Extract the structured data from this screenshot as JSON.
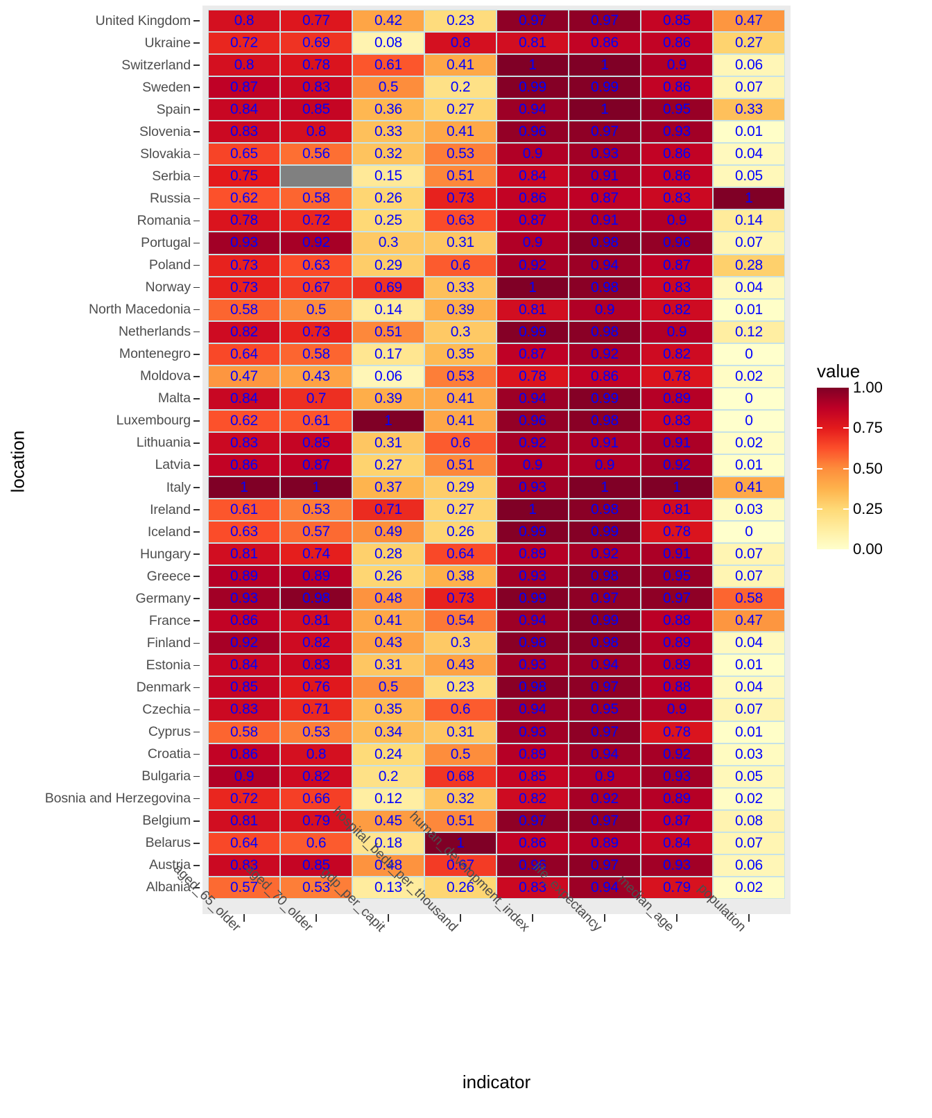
{
  "axes": {
    "y_title": "location",
    "x_title": "indicator"
  },
  "legend": {
    "title": "value",
    "ticks": [
      "1.00",
      "0.75",
      "0.50",
      "0.25",
      "0.00"
    ],
    "tick_values": [
      1.0,
      0.75,
      0.5,
      0.25,
      0.0
    ],
    "low_color": "#ffffcc",
    "high_color": "#800026",
    "na_color": "#808080"
  },
  "chart_data": {
    "type": "heatmap",
    "title": "",
    "xlabel": "indicator",
    "ylabel": "location",
    "legend_title": "value",
    "zlim": [
      0,
      1
    ],
    "grid": false,
    "legend_position": "right",
    "na_color": "#808080",
    "colormap": [
      "#ffffcc",
      "#ffeda0",
      "#fed976",
      "#feb24c",
      "#fd8d3c",
      "#fc4e2a",
      "#e31a1c",
      "#bd0026",
      "#800026"
    ],
    "columns": [
      "aged_65_older",
      "aged_70_older",
      "gdp_per_capit",
      "hospital_beds_per_thousand",
      "human_development_index",
      "life_expectancy",
      "median_age",
      "population"
    ],
    "rows": [
      "United Kingdom",
      "Ukraine",
      "Switzerland",
      "Sweden",
      "Spain",
      "Slovenia",
      "Slovakia",
      "Serbia",
      "Russia",
      "Romania",
      "Portugal",
      "Poland",
      "Norway",
      "North Macedonia",
      "Netherlands",
      "Montenegro",
      "Moldova",
      "Malta",
      "Luxembourg",
      "Lithuania",
      "Latvia",
      "Italy",
      "Ireland",
      "Iceland",
      "Hungary",
      "Greece",
      "Germany",
      "France",
      "Finland",
      "Estonia",
      "Denmark",
      "Czechia",
      "Cyprus",
      "Croatia",
      "Bulgaria",
      "Bosnia and Herzegovina",
      "Belgium",
      "Belarus",
      "Austria",
      "Albania"
    ],
    "values": [
      [
        0.8,
        0.77,
        0.42,
        0.23,
        0.97,
        0.97,
        0.85,
        0.47
      ],
      [
        0.72,
        0.69,
        0.08,
        0.8,
        0.81,
        0.86,
        0.86,
        0.27
      ],
      [
        0.8,
        0.78,
        0.61,
        0.41,
        1,
        1,
        0.9,
        0.06
      ],
      [
        0.87,
        0.83,
        0.5,
        0.2,
        0.99,
        0.99,
        0.86,
        0.07
      ],
      [
        0.84,
        0.85,
        0.36,
        0.27,
        0.94,
        1,
        0.95,
        0.33
      ],
      [
        0.83,
        0.8,
        0.33,
        0.41,
        0.96,
        0.97,
        0.93,
        0.01
      ],
      [
        0.65,
        0.56,
        0.32,
        0.53,
        0.9,
        0.93,
        0.86,
        0.04
      ],
      [
        0.75,
        null,
        0.15,
        0.51,
        0.84,
        0.91,
        0.86,
        0.05
      ],
      [
        0.62,
        0.58,
        0.26,
        0.73,
        0.86,
        0.87,
        0.83,
        1
      ],
      [
        0.78,
        0.72,
        0.25,
        0.63,
        0.87,
        0.91,
        0.9,
        0.14
      ],
      [
        0.93,
        0.92,
        0.3,
        0.31,
        0.9,
        0.98,
        0.96,
        0.07
      ],
      [
        0.73,
        0.63,
        0.29,
        0.6,
        0.92,
        0.94,
        0.87,
        0.28
      ],
      [
        0.73,
        0.67,
        0.69,
        0.33,
        1,
        0.98,
        0.83,
        0.04
      ],
      [
        0.58,
        0.5,
        0.14,
        0.39,
        0.81,
        0.9,
        0.82,
        0.01
      ],
      [
        0.82,
        0.73,
        0.51,
        0.3,
        0.99,
        0.98,
        0.9,
        0.12
      ],
      [
        0.64,
        0.58,
        0.17,
        0.35,
        0.87,
        0.92,
        0.82,
        0
      ],
      [
        0.47,
        0.43,
        0.06,
        0.53,
        0.78,
        0.86,
        0.78,
        0.02
      ],
      [
        0.84,
        0.7,
        0.39,
        0.41,
        0.94,
        0.99,
        0.89,
        0
      ],
      [
        0.62,
        0.61,
        1,
        0.41,
        0.96,
        0.98,
        0.83,
        0
      ],
      [
        0.83,
        0.85,
        0.31,
        0.6,
        0.92,
        0.91,
        0.91,
        0.02
      ],
      [
        0.86,
        0.87,
        0.27,
        0.51,
        0.9,
        0.9,
        0.92,
        0.01
      ],
      [
        1,
        1,
        0.37,
        0.29,
        0.93,
        1,
        1,
        0.41
      ],
      [
        0.61,
        0.53,
        0.71,
        0.27,
        1,
        0.98,
        0.81,
        0.03
      ],
      [
        0.63,
        0.57,
        0.49,
        0.26,
        0.99,
        0.99,
        0.78,
        0
      ],
      [
        0.81,
        0.74,
        0.28,
        0.64,
        0.89,
        0.92,
        0.91,
        0.07
      ],
      [
        0.89,
        0.89,
        0.26,
        0.38,
        0.93,
        0.98,
        0.95,
        0.07
      ],
      [
        0.93,
        0.98,
        0.48,
        0.73,
        0.99,
        0.97,
        0.97,
        0.58
      ],
      [
        0.86,
        0.81,
        0.41,
        0.54,
        0.94,
        0.99,
        0.88,
        0.47
      ],
      [
        0.92,
        0.82,
        0.43,
        0.3,
        0.98,
        0.98,
        0.89,
        0.04
      ],
      [
        0.84,
        0.83,
        0.31,
        0.43,
        0.93,
        0.94,
        0.89,
        0.01
      ],
      [
        0.85,
        0.76,
        0.5,
        0.23,
        0.98,
        0.97,
        0.88,
        0.04
      ],
      [
        0.83,
        0.71,
        0.35,
        0.6,
        0.94,
        0.95,
        0.9,
        0.07
      ],
      [
        0.58,
        0.53,
        0.34,
        0.31,
        0.93,
        0.97,
        0.78,
        0.01
      ],
      [
        0.86,
        0.8,
        0.24,
        0.5,
        0.89,
        0.94,
        0.92,
        0.03
      ],
      [
        0.9,
        0.82,
        0.2,
        0.68,
        0.85,
        0.9,
        0.93,
        0.05
      ],
      [
        0.72,
        0.66,
        0.12,
        0.32,
        0.82,
        0.92,
        0.89,
        0.02
      ],
      [
        0.81,
        0.79,
        0.45,
        0.51,
        0.97,
        0.97,
        0.87,
        0.08
      ],
      [
        0.64,
        0.6,
        0.18,
        1,
        0.86,
        0.89,
        0.84,
        0.07
      ],
      [
        0.83,
        0.85,
        0.48,
        0.67,
        0.96,
        0.97,
        0.93,
        0.06
      ],
      [
        0.57,
        0.53,
        0.13,
        0.26,
        0.83,
        0.94,
        0.79,
        0.02
      ]
    ],
    "labels": [
      [
        "0.8",
        "0.77",
        "0.42",
        "0.23",
        "0.97",
        "0.97",
        "0.85",
        "0.47"
      ],
      [
        "0.72",
        "0.69",
        "0.08",
        "0.8",
        "0.81",
        "0.86",
        "0.86",
        "0.27"
      ],
      [
        "0.8",
        "0.78",
        "0.61",
        "0.41",
        "1",
        "1",
        "0.9",
        "0.06"
      ],
      [
        "0.87",
        "0.83",
        "0.5",
        "0.2",
        "0.99",
        "0.99",
        "0.86",
        "0.07"
      ],
      [
        "0.84",
        "0.85",
        "0.36",
        "0.27",
        "0.94",
        "1",
        "0.95",
        "0.33"
      ],
      [
        "0.83",
        "0.8",
        "0.33",
        "0.41",
        "0.96",
        "0.97",
        "0.93",
        "0.01"
      ],
      [
        "0.65",
        "0.56",
        "0.32",
        "0.53",
        "0.9",
        "0.93",
        "0.86",
        "0.04"
      ],
      [
        "0.75",
        "",
        "0.15",
        "0.51",
        "0.84",
        "0.91",
        "0.86",
        "0.05"
      ],
      [
        "0.62",
        "0.58",
        "0.26",
        "0.73",
        "0.86",
        "0.87",
        "0.83",
        "1"
      ],
      [
        "0.78",
        "0.72",
        "0.25",
        "0.63",
        "0.87",
        "0.91",
        "0.9",
        "0.14"
      ],
      [
        "0.93",
        "0.92",
        "0.3",
        "0.31",
        "0.9",
        "0.98",
        "0.96",
        "0.07"
      ],
      [
        "0.73",
        "0.63",
        "0.29",
        "0.6",
        "0.92",
        "0.94",
        "0.87",
        "0.28"
      ],
      [
        "0.73",
        "0.67",
        "0.69",
        "0.33",
        "1",
        "0.98",
        "0.83",
        "0.04"
      ],
      [
        "0.58",
        "0.5",
        "0.14",
        "0.39",
        "0.81",
        "0.9",
        "0.82",
        "0.01"
      ],
      [
        "0.82",
        "0.73",
        "0.51",
        "0.3",
        "0.99",
        "0.98",
        "0.9",
        "0.12"
      ],
      [
        "0.64",
        "0.58",
        "0.17",
        "0.35",
        "0.87",
        "0.92",
        "0.82",
        "0"
      ],
      [
        "0.47",
        "0.43",
        "0.06",
        "0.53",
        "0.78",
        "0.86",
        "0.78",
        "0.02"
      ],
      [
        "0.84",
        "0.7",
        "0.39",
        "0.41",
        "0.94",
        "0.99",
        "0.89",
        "0"
      ],
      [
        "0.62",
        "0.61",
        "1",
        "0.41",
        "0.96",
        "0.98",
        "0.83",
        "0"
      ],
      [
        "0.83",
        "0.85",
        "0.31",
        "0.6",
        "0.92",
        "0.91",
        "0.91",
        "0.02"
      ],
      [
        "0.86",
        "0.87",
        "0.27",
        "0.51",
        "0.9",
        "0.9",
        "0.92",
        "0.01"
      ],
      [
        "1",
        "1",
        "0.37",
        "0.29",
        "0.93",
        "1",
        "1",
        "0.41"
      ],
      [
        "0.61",
        "0.53",
        "0.71",
        "0.27",
        "1",
        "0.98",
        "0.81",
        "0.03"
      ],
      [
        "0.63",
        "0.57",
        "0.49",
        "0.26",
        "0.99",
        "0.99",
        "0.78",
        "0"
      ],
      [
        "0.81",
        "0.74",
        "0.28",
        "0.64",
        "0.89",
        "0.92",
        "0.91",
        "0.07"
      ],
      [
        "0.89",
        "0.89",
        "0.26",
        "0.38",
        "0.93",
        "0.98",
        "0.95",
        "0.07"
      ],
      [
        "0.93",
        "0.98",
        "0.48",
        "0.73",
        "0.99",
        "0.97",
        "0.97",
        "0.58"
      ],
      [
        "0.86",
        "0.81",
        "0.41",
        "0.54",
        "0.94",
        "0.99",
        "0.88",
        "0.47"
      ],
      [
        "0.92",
        "0.82",
        "0.43",
        "0.3",
        "0.98",
        "0.98",
        "0.89",
        "0.04"
      ],
      [
        "0.84",
        "0.83",
        "0.31",
        "0.43",
        "0.93",
        "0.94",
        "0.89",
        "0.01"
      ],
      [
        "0.85",
        "0.76",
        "0.5",
        "0.23",
        "0.98",
        "0.97",
        "0.88",
        "0.04"
      ],
      [
        "0.83",
        "0.71",
        "0.35",
        "0.6",
        "0.94",
        "0.95",
        "0.9",
        "0.07"
      ],
      [
        "0.58",
        "0.53",
        "0.34",
        "0.31",
        "0.93",
        "0.97",
        "0.78",
        "0.01"
      ],
      [
        "0.86",
        "0.8",
        "0.24",
        "0.5",
        "0.89",
        "0.94",
        "0.92",
        "0.03"
      ],
      [
        "0.9",
        "0.82",
        "0.2",
        "0.68",
        "0.85",
        "0.9",
        "0.93",
        "0.05"
      ],
      [
        "0.72",
        "0.66",
        "0.12",
        "0.32",
        "0.82",
        "0.92",
        "0.89",
        "0.02"
      ],
      [
        "0.81",
        "0.79",
        "0.45",
        "0.51",
        "0.97",
        "0.97",
        "0.87",
        "0.08"
      ],
      [
        "0.64",
        "0.6",
        "0.18",
        "1",
        "0.86",
        "0.89",
        "0.84",
        "0.07"
      ],
      [
        "0.83",
        "0.85",
        "0.48",
        "0.67",
        "0.96",
        "0.97",
        "0.93",
        "0.06"
      ],
      [
        "0.57",
        "0.53",
        "0.13",
        "0.26",
        "0.83",
        "0.94",
        "0.79",
        "0.02"
      ]
    ]
  }
}
